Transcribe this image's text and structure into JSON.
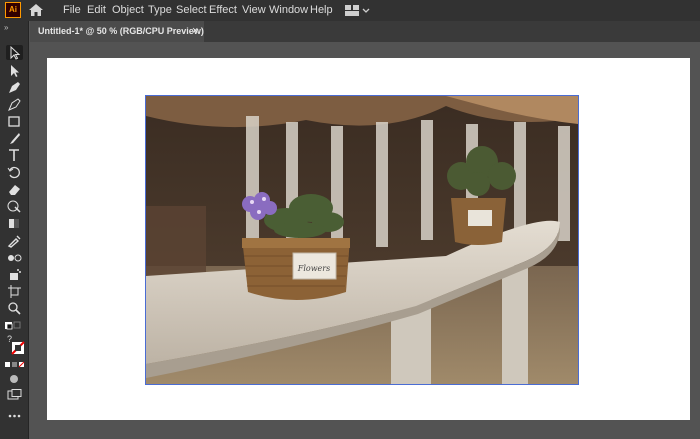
{
  "app": {
    "logo": "Ai"
  },
  "menu": [
    "File",
    "Edit",
    "Object",
    "Type",
    "Select",
    "Effect",
    "View",
    "Window",
    "Help"
  ],
  "document_tab": {
    "title": "Untitled-1* @ 50 % (RGB/CPU Preview)",
    "close": "×"
  },
  "icons": {
    "home": "home-icon",
    "workspace": "workspace-switcher-icon",
    "tools": [
      "selection-tool-icon",
      "direct-selection-tool-icon",
      "pen-tool-icon",
      "curvature-tool-icon",
      "rectangle-tool-icon",
      "paintbrush-tool-icon",
      "type-tool-icon",
      "rotate-tool-icon",
      "eraser-tool-icon",
      "shape-builder-tool-icon",
      "gradient-tool-icon",
      "eyedropper-tool-icon",
      "blend-tool-icon",
      "symbol-sprayer-tool-icon",
      "artboard-tool-icon",
      "zoom-tool-icon",
      "fill-stroke-swatch-icon",
      "color-mode-icon",
      "draw-mode-icon",
      "screen-mode-icon",
      "more-tools-icon"
    ]
  },
  "photo": {
    "label_text": "Flowers"
  },
  "colors": {
    "accent": "#4a6cd4",
    "brand": "#ff9a00"
  }
}
